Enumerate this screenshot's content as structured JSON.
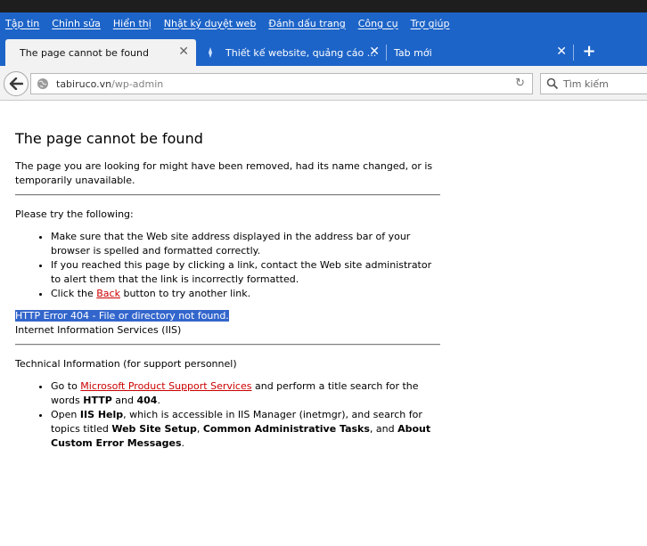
{
  "menubar": {
    "items": [
      "Tập tin",
      "Chỉnh sửa",
      "Hiển thị",
      "Nhật ký duyệt web",
      "Đánh dấu trang",
      "Công cụ",
      "Trợ giúp"
    ]
  },
  "tabs": [
    {
      "label": "The page cannot be found",
      "active": true
    },
    {
      "label": "Thiết kế website, quảng cáo ...",
      "active": false
    },
    {
      "label": "Tab mới",
      "active": false
    }
  ],
  "navbar": {
    "url_host": "tabiruco.vn",
    "url_path": "/wp-admin",
    "search_placeholder": "Tìm kiếm"
  },
  "page": {
    "title": "The page cannot be found",
    "intro": "The page you are looking for might have been removed, had its name changed, or is temporarily unavailable.",
    "try_heading": "Please try the following:",
    "try_item1": "Make sure that the Web site address displayed in the address bar of your browser is spelled and formatted correctly.",
    "try_item2": "If you reached this page by clicking a link, contact the Web site administrator to alert them that the link is incorrectly formatted.",
    "try_item3_pre": "Click the ",
    "try_item3_link": "Back",
    "try_item3_post": " button to try another link.",
    "error_line": "HTTP Error 404 - File or directory not found.",
    "server_line": "Internet Information Services (IIS)",
    "tech_heading": "Technical Information (for support personnel)",
    "tech1_pre": "Go to ",
    "tech1_link": "Microsoft Product Support Services",
    "tech1_mid": " and perform a title search for the words ",
    "tech1_b1": "HTTP",
    "tech1_and": " and ",
    "tech1_b2": "404",
    "tech1_end": ".",
    "tech2_pre": "Open ",
    "tech2_b1": "IIS Help",
    "tech2_mid": ", which is accessible in IIS Manager (inetmgr), and search for topics titled ",
    "tech2_b2": "Web Site Setup",
    "tech2_sep": ", ",
    "tech2_b3": "Common Administrative Tasks",
    "tech2_and": ", and ",
    "tech2_b4": "About Custom Error Messages",
    "tech2_end": "."
  },
  "colors": {
    "chrome_blue": "#1d64c8",
    "link_red": "#cc0000",
    "selection": "#3366cc"
  }
}
